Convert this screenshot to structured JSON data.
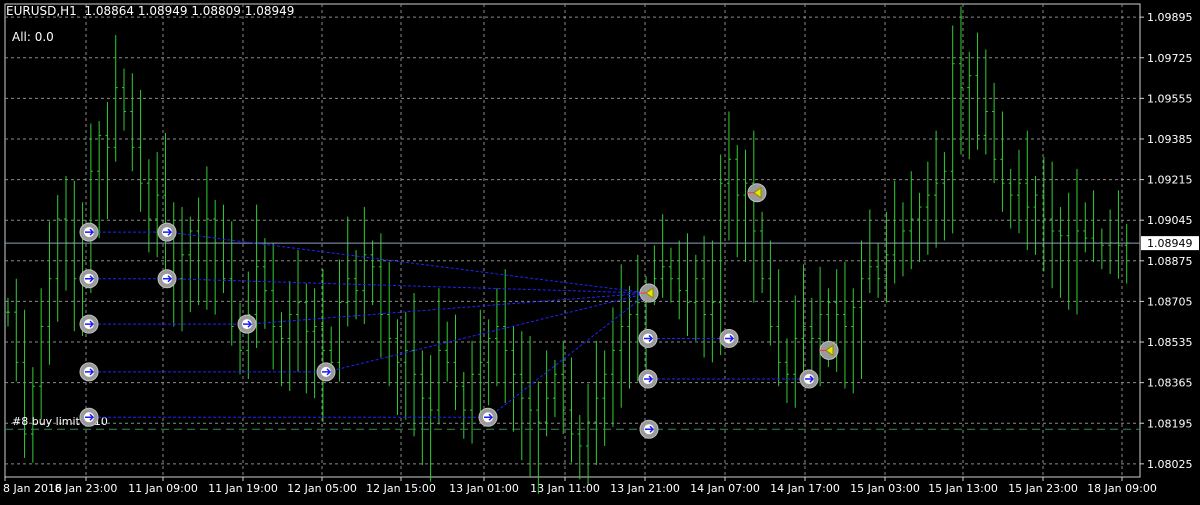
{
  "header": {
    "symbol_line": "EURUSD,H1  1.08864 1.08949 1.08809 1.08949",
    "all_label": "All: 0.0"
  },
  "colors": {
    "background": "#000000",
    "grid": "#8a8a8a",
    "bars": "#32cd32",
    "axis_text": "#ffffff",
    "price_label_bg": "#ffffff",
    "price_label_text": "#000000",
    "order_line": "#2e8b57",
    "trade_line": "#2222ff",
    "marker": "#9a9a9a"
  },
  "chart_data": {
    "type": "ohlc",
    "symbol": "EURUSD",
    "timeframe": "H1",
    "ylim": [
      1.0797,
      1.0995
    ],
    "y_ticks": [
      "1.09895",
      "1.09725",
      "1.09555",
      "1.09385",
      "1.09215",
      "1.09045",
      "1.08875",
      "1.08705",
      "1.08535",
      "1.08365",
      "1.08195",
      "1.08025"
    ],
    "x_ticks": [
      "8 Jan 2016",
      "8 Jan 23:00",
      "11 Jan 09:00",
      "11 Jan 19:00",
      "12 Jan 05:00",
      "12 Jan 15:00",
      "13 Jan 01:00",
      "13 Jan 11:00",
      "13 Jan 21:00",
      "14 Jan 07:00",
      "14 Jan 17:00",
      "15 Jan 03:00",
      "15 Jan 13:00",
      "15 Jan 23:00",
      "18 Jan 09:00"
    ],
    "current_price": "1.08949",
    "order_label": "#8 buy limit 0.10",
    "order_price": 1.0817,
    "closes": [
      1.0866,
      1.0845,
      1.0815,
      1.0835,
      1.086,
      1.088,
      1.0905,
      1.0895,
      1.088,
      1.09,
      1.0925,
      1.094,
      1.0935,
      1.096,
      1.095,
      1.0935,
      1.092,
      1.0905,
      1.0915,
      1.09,
      1.088,
      1.089,
      1.09,
      1.0895,
      1.0905,
      1.0895,
      1.088,
      1.086,
      1.085,
      1.0865,
      1.0885,
      1.0875,
      1.086,
      1.0855,
      1.0865,
      1.087,
      1.0858,
      1.086,
      1.085,
      1.0845,
      1.087,
      1.088,
      1.0875,
      1.089,
      1.0885,
      1.0865,
      1.0855,
      1.0845,
      1.085,
      1.084,
      1.083,
      1.0825,
      1.085,
      1.0845,
      1.0835,
      1.0825,
      1.084,
      1.0845,
      1.0855,
      1.086,
      1.085,
      1.084,
      1.083,
      1.0825,
      1.082,
      1.083,
      1.084,
      1.0825,
      1.0815,
      1.081,
      1.082,
      1.083,
      1.084,
      1.085,
      1.086,
      1.0865,
      1.087,
      1.0875,
      1.088,
      1.0885,
      1.088,
      1.0875,
      1.087,
      1.088,
      1.0865,
      1.087,
      1.092,
      1.093,
      1.0915,
      1.092,
      1.09,
      1.088,
      1.086,
      1.0845,
      1.084,
      1.0855,
      1.086,
      1.0855,
      1.0865,
      1.087,
      1.0865,
      1.086,
      1.0868,
      1.088,
      1.0885,
      1.088,
      1.089,
      1.0895,
      1.09,
      1.0905,
      1.091,
      1.0915,
      1.092,
      1.0925,
      1.097,
      1.096,
      1.0965,
      1.094,
      1.095,
      1.093,
      1.092,
      1.0915,
      1.092,
      1.091,
      1.0915,
      1.0905,
      1.09,
      1.0898,
      1.0895,
      1.09,
      1.0897,
      1.0895,
      1.0894,
      1.0895,
      1.0894,
      1.0895
    ],
    "trades": [
      {
        "id": "t1",
        "open": {
          "time": "8 Jan 23:00",
          "price": 1.08995
        },
        "close": {
          "time": "11 Jan 09:00",
          "price": 1.08995
        }
      },
      {
        "id": "t2",
        "open": {
          "time": "8 Jan 23:00",
          "price": 1.088
        },
        "close": {
          "time": "11 Jan 09:00",
          "price": 1.088
        }
      },
      {
        "id": "t3",
        "open": {
          "time": "8 Jan 23:00",
          "price": 1.0861
        },
        "close": {
          "time": "11 Jan 19:00",
          "price": 1.0861
        }
      },
      {
        "id": "t4",
        "open": {
          "time": "8 Jan 23:00",
          "price": 1.0841
        },
        "close": {
          "time": "12 Jan 05:00",
          "price": 1.0841
        }
      },
      {
        "id": "t5",
        "open": {
          "time": "8 Jan 23:00",
          "price": 1.0822
        },
        "close": {
          "time": "13 Jan 01:00",
          "price": 1.0822
        }
      },
      {
        "id": "t6",
        "open": {
          "time": "13 Jan 21:00",
          "price": 1.0855
        },
        "close": {
          "time": "14 Jan 07:00",
          "price": 1.0855
        }
      },
      {
        "id": "t7",
        "open": {
          "time": "13 Jan 21:00",
          "price": 1.0838
        },
        "close": {
          "time": "14 Jan 17:00",
          "price": 1.0838
        }
      }
    ],
    "sell_markers": [
      {
        "time": "13 Jan 21:00",
        "price": 1.0874
      },
      {
        "time": "14 Jan 07:00",
        "price": 1.0916
      },
      {
        "time": "14 Jan 17:00",
        "price": 1.085
      }
    ],
    "pending_marker": {
      "time": "13 Jan 21:00",
      "price": 1.0817
    }
  }
}
